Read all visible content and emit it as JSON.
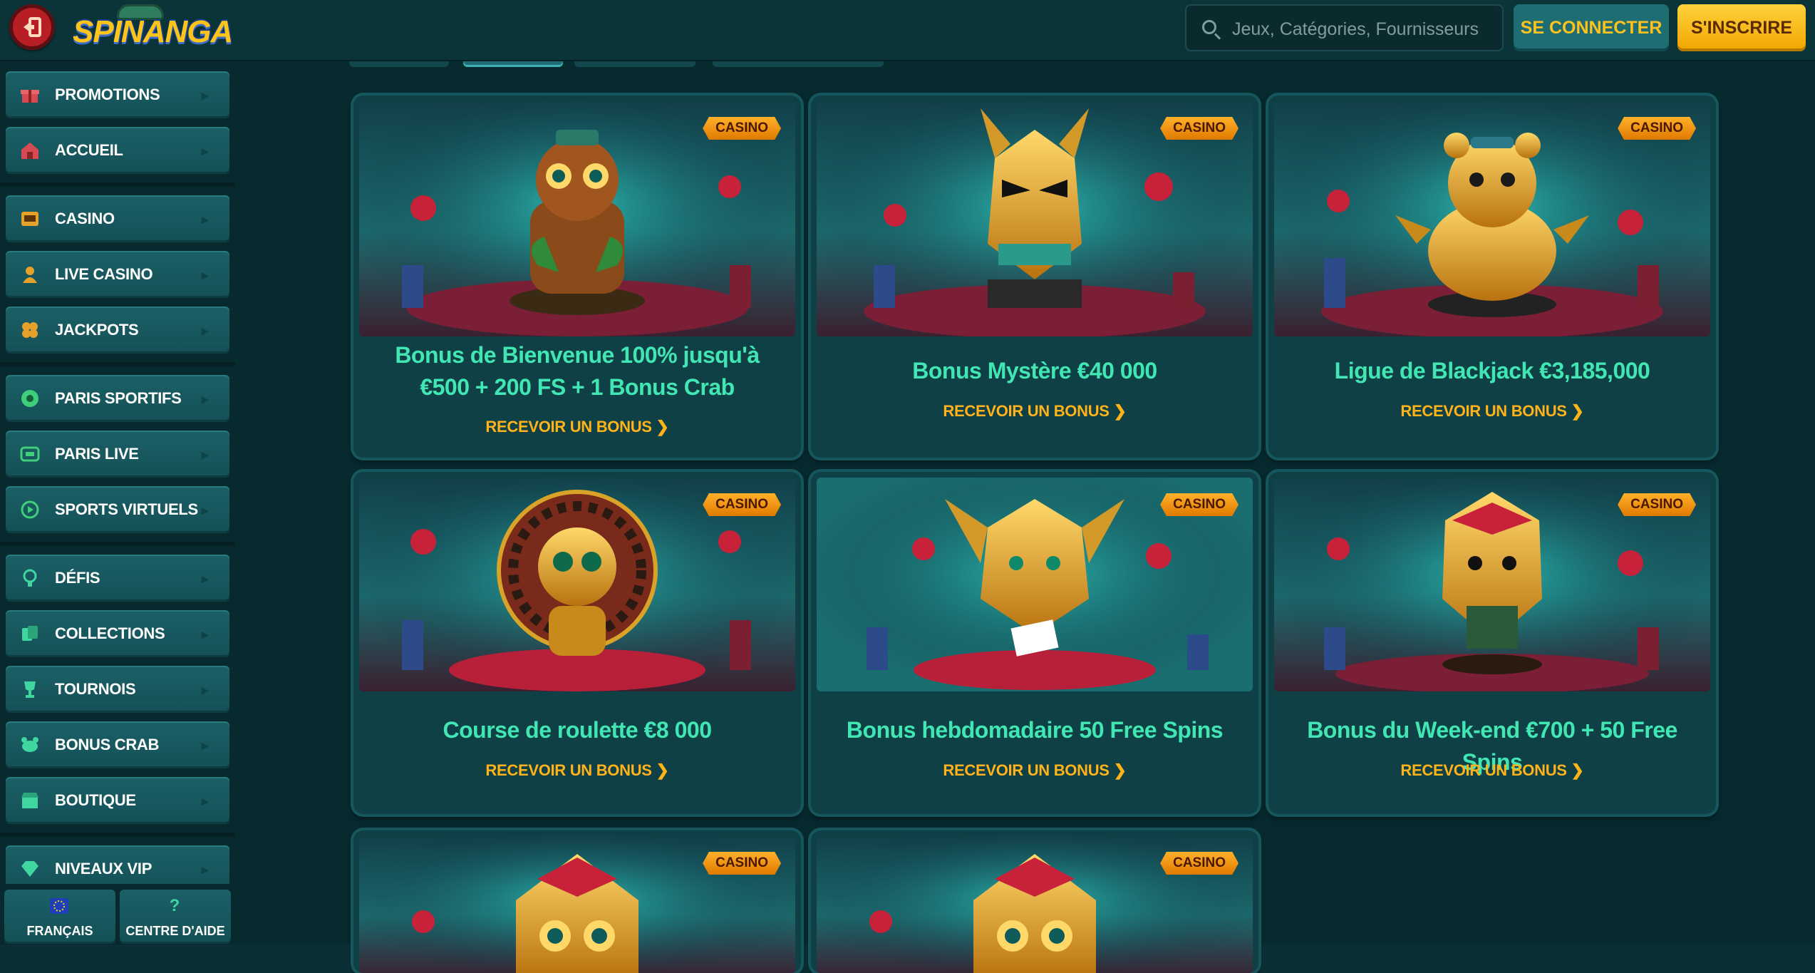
{
  "header": {
    "logo_text": "SPINANGA",
    "menu_icon": "exit-icon",
    "search_placeholder": "Jeux, Catégories, Fournisseurs",
    "login_label": "SE CONNECTER",
    "signup_label": "S'INSCRIRE"
  },
  "sidebar": {
    "items": [
      {
        "label": "PROMOTIONS",
        "icon": "gift-icon",
        "color": "#d84a52"
      },
      {
        "label": "ACCUEIL",
        "icon": "house-icon",
        "color": "#d84a52"
      },
      {
        "label": "CASINO",
        "icon": "slot-machine-icon",
        "color": "#e6a12a"
      },
      {
        "label": "LIVE CASINO",
        "icon": "dealer-icon",
        "color": "#e6a12a"
      },
      {
        "label": "JACKPOTS",
        "icon": "clover-icon",
        "color": "#e6a12a"
      },
      {
        "label": "PARIS SPORTIFS",
        "icon": "football-icon",
        "color": "#3fcf7a"
      },
      {
        "label": "PARIS LIVE",
        "icon": "live-icon",
        "color": "#3fcf7a"
      },
      {
        "label": "SPORTS VIRTUELS",
        "icon": "virtual-sport-icon",
        "color": "#3fcf7a"
      },
      {
        "label": "DÉFIS",
        "icon": "challenge-icon",
        "color": "#3fd6a0"
      },
      {
        "label": "COLLECTIONS",
        "icon": "cards-icon",
        "color": "#3fd6a0"
      },
      {
        "label": "TOURNOIS",
        "icon": "trophy-icon",
        "color": "#3fd6a0"
      },
      {
        "label": "BONUS CRAB",
        "icon": "crab-icon",
        "color": "#3fd6a0"
      },
      {
        "label": "BOUTIQUE",
        "icon": "shop-icon",
        "color": "#3fd6a0"
      },
      {
        "label": "NIVEAUX VIP",
        "icon": "diamond-icon",
        "color": "#3fd6a0"
      }
    ],
    "language_label": "FRANÇAIS",
    "help_label": "CENTRE D'AIDE",
    "help_icon": "?"
  },
  "promotions": [
    {
      "badge": "CASINO",
      "title": "Bonus de Bienvenue 100% jusqu'à €500 + 200 FS + 1 Bonus Crab",
      "cta": "RECEVOIR UN BONUS ❯",
      "mascot": "monkey"
    },
    {
      "badge": "CASINO",
      "title": "Bonus Mystère €40 000",
      "cta": "RECEVOIR UN BONUS ❯",
      "mascot": "wolf"
    },
    {
      "badge": "CASINO",
      "title": "Ligue de Blackjack €3,185,000",
      "cta": "RECEVOIR UN BONUS ❯",
      "mascot": "bear"
    },
    {
      "badge": "CASINO",
      "title": "Course de roulette €8 000",
      "cta": "RECEVOIR UN BONUS ❯",
      "mascot": "roulette-monkey"
    },
    {
      "badge": "CASINO",
      "title": "Bonus hebdomadaire 50 Free Spins",
      "cta": "RECEVOIR UN BONUS ❯",
      "mascot": "fox"
    },
    {
      "badge": "CASINO",
      "title": "Bonus du Week-end €700 + 50 Free Spins",
      "cta": "RECEVOIR UN BONUS ❯",
      "mascot": "tiki-dog"
    },
    {
      "badge": "CASINO",
      "title": "",
      "cta": "",
      "mascot": "tiki-monkey"
    },
    {
      "badge": "CASINO",
      "title": "",
      "cta": "",
      "mascot": "tiki-monkey"
    }
  ]
}
